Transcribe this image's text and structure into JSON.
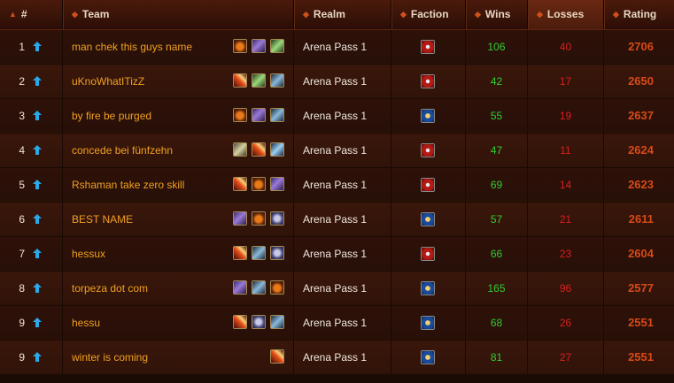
{
  "header": {
    "rank": "#",
    "team": "Team",
    "realm": "Realm",
    "faction": "Faction",
    "wins": "Wins",
    "losses": "Losses",
    "rating": "Rating"
  },
  "colors": {
    "wins": "#33cc33",
    "losses": "#d92020",
    "rating": "#d84a16",
    "team_name": "#f0a020",
    "horde": "#b31a14",
    "alliance": "#1a4a9a"
  },
  "rows": [
    {
      "rank": "1",
      "team": "man chek this guys name",
      "realm": "Arena Pass 1",
      "faction": "horde",
      "wins": "106",
      "losses": "40",
      "rating": "2706",
      "classes": [
        "druid-icon",
        "warlock-icon",
        "hunter-icon"
      ]
    },
    {
      "rank": "2",
      "team": "uKnoWhatITizZ",
      "realm": "Arena Pass 1",
      "faction": "horde",
      "wins": "42",
      "losses": "17",
      "rating": "2650",
      "classes": [
        "mage-icon",
        "hunter-icon",
        "rogue-icon"
      ]
    },
    {
      "rank": "3",
      "team": "by fire be purged",
      "realm": "Arena Pass 1",
      "faction": "alliance",
      "wins": "55",
      "losses": "19",
      "rating": "2637",
      "classes": [
        "druid-icon",
        "warlock-icon",
        "rogue-icon"
      ]
    },
    {
      "rank": "4",
      "team": "concede bei fünfzehn",
      "realm": "Arena Pass 1",
      "faction": "horde",
      "wins": "47",
      "losses": "11",
      "rating": "2624",
      "classes": [
        "paladin-icon",
        "mage-icon",
        "shaman-icon"
      ]
    },
    {
      "rank": "5",
      "team": "Rshaman take zero skill",
      "realm": "Arena Pass 1",
      "faction": "horde",
      "wins": "69",
      "losses": "14",
      "rating": "2623",
      "classes": [
        "mage-icon",
        "druid-icon",
        "warlock-icon"
      ]
    },
    {
      "rank": "6",
      "team": "BEST NAME",
      "realm": "Arena Pass 1",
      "faction": "alliance",
      "wins": "57",
      "losses": "21",
      "rating": "2611",
      "classes": [
        "warlock-icon",
        "druid-icon",
        "priest-icon"
      ]
    },
    {
      "rank": "7",
      "team": "hessux",
      "realm": "Arena Pass 1",
      "faction": "horde",
      "wins": "66",
      "losses": "23",
      "rating": "2604",
      "classes": [
        "mage-icon",
        "rogue-icon",
        "priest-icon"
      ]
    },
    {
      "rank": "8",
      "team": "torpeza dot com",
      "realm": "Arena Pass 1",
      "faction": "alliance",
      "wins": "165",
      "losses": "96",
      "rating": "2577",
      "classes": [
        "warlock-icon",
        "rogue-icon",
        "druid-icon"
      ]
    },
    {
      "rank": "9",
      "team": "hessu",
      "realm": "Arena Pass 1",
      "faction": "alliance",
      "wins": "68",
      "losses": "26",
      "rating": "2551",
      "classes": [
        "mage-icon",
        "priest-icon",
        "rogue-icon"
      ]
    },
    {
      "rank": "9",
      "team": "winter is coming",
      "realm": "Arena Pass 1",
      "faction": "alliance",
      "wins": "81",
      "losses": "27",
      "rating": "2551",
      "classes": [
        "mage-icon"
      ]
    }
  ]
}
